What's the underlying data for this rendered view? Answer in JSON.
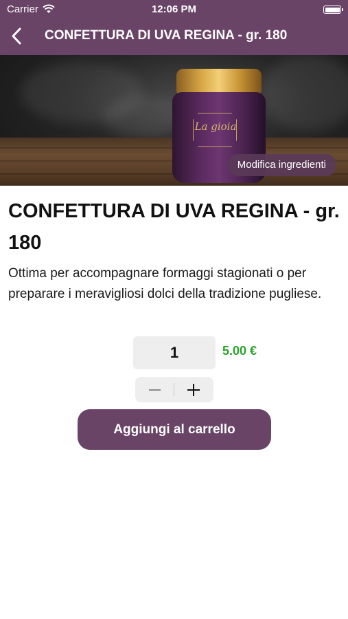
{
  "status_bar": {
    "carrier": "Carrier",
    "time": "12:06 PM"
  },
  "nav": {
    "title": "CONFETTURA DI UVA REGINA - gr. 180",
    "back_icon": "chevron-left-icon"
  },
  "hero": {
    "jar_brand": "La gioia",
    "edit_button_label": "Modifica ingredienti"
  },
  "product": {
    "title": "CONFETTURA DI UVA REGINA - gr. 180",
    "description": "Ottima per accompagnare formaggi stagionati o per preparare i meravigliosi dolci della tradizione pugliese.",
    "quantity": "1",
    "price": "5.00 €"
  },
  "stepper": {
    "minus_icon": "minus-icon",
    "plus_icon": "plus-icon"
  },
  "actions": {
    "add_to_cart_label": "Aggiungi al carrello"
  },
  "colors": {
    "brand": "#6a4466",
    "price": "#2aa12a",
    "field_bg": "#eeeeee"
  }
}
